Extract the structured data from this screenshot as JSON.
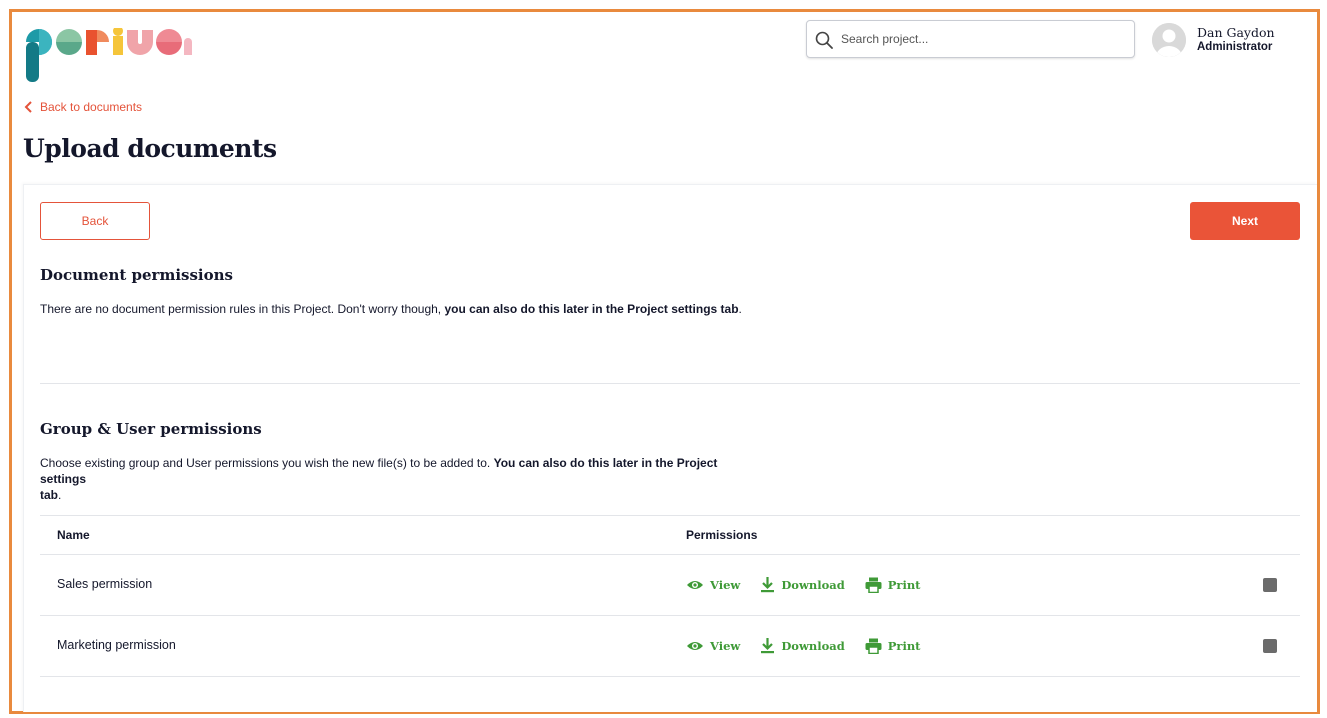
{
  "brand": {
    "logo_text": "periuen",
    "accent": "#ea5438",
    "frame": "#e98a3e",
    "success": "#3f9a37"
  },
  "search": {
    "placeholder": "Search project..."
  },
  "user": {
    "name": "Dan Gaydon",
    "role": "Administrator"
  },
  "nav": {
    "back_link": "Back to documents"
  },
  "page": {
    "title": "Upload documents"
  },
  "actions": {
    "back_label": "Back",
    "next_label": "Next"
  },
  "document_permissions": {
    "title": "Document permissions",
    "text": "There are no document permission rules in this Project. Don't worry though, ",
    "text_bold": "you can also do this later in the Project settings tab",
    "text_end": "."
  },
  "group_permissions": {
    "title": "Group & User permissions",
    "text": "Choose existing group and User permissions you wish the new file(s) to be added to. ",
    "text_bold_1": "You can also do this later in the Project settings",
    "text_bold_2": "tab",
    "text_end": "."
  },
  "table": {
    "headers": {
      "name": "Name",
      "permissions": "Permissions"
    },
    "rows": [
      {
        "name": "Sales permission",
        "perms": [
          "View",
          "Download",
          "Print"
        ],
        "checked": true
      },
      {
        "name": "Marketing permission",
        "perms": [
          "View",
          "Download",
          "Print"
        ],
        "checked": true
      }
    ]
  },
  "icons": {
    "search": "search-icon",
    "avatar": "user-avatar-icon",
    "back": "chevron-left-icon",
    "view": "eye-icon",
    "download": "download-icon",
    "print": "printer-icon"
  }
}
